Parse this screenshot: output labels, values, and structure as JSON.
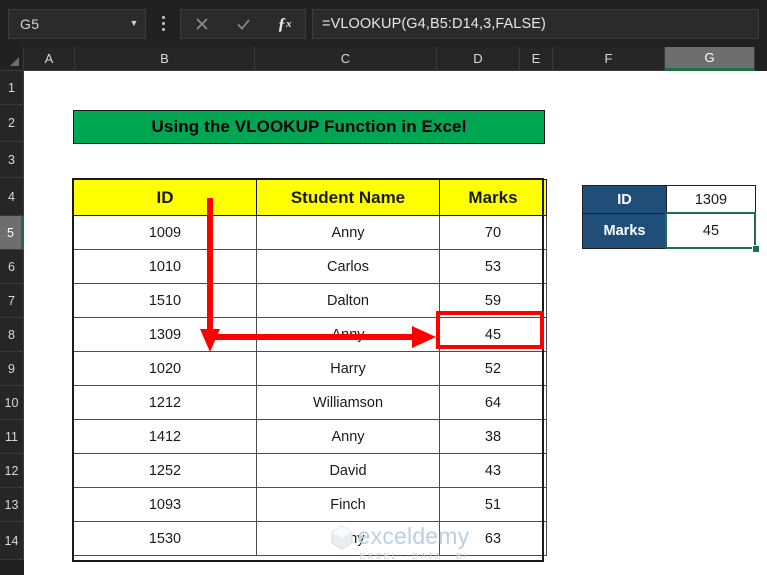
{
  "app": {
    "name_box": "G5",
    "formula": "=VLOOKUP(G4,B5:D14,3,FALSE)",
    "cancel_icon": "close-icon",
    "confirm_icon": "check-icon",
    "fx_icon": "fx-icon",
    "caret_icon": "chevron-down-icon",
    "menu_icon": "kebab-menu-icon"
  },
  "grid": {
    "columns": [
      "A",
      "B",
      "C",
      "D",
      "E",
      "F",
      "G"
    ],
    "selected_column": "G",
    "rows": [
      "1",
      "2",
      "3",
      "4",
      "5",
      "6",
      "7",
      "8",
      "9",
      "10",
      "11",
      "12",
      "13",
      "14"
    ],
    "selected_row": "5"
  },
  "banner": {
    "title": "Using the VLOOKUP Function in Excel",
    "bg_color": "#00a651",
    "text_color": "#000000"
  },
  "table": {
    "header_bg": "#ffff00",
    "headers": [
      "ID",
      "Student Name",
      "Marks"
    ],
    "rows": [
      {
        "id": "1009",
        "name": "Anny",
        "marks": "70"
      },
      {
        "id": "1010",
        "name": "Carlos",
        "marks": "53"
      },
      {
        "id": "1510",
        "name": "Dalton",
        "marks": "59"
      },
      {
        "id": "1309",
        "name": "Anny",
        "marks": "45"
      },
      {
        "id": "1020",
        "name": "Harry",
        "marks": "52"
      },
      {
        "id": "1212",
        "name": "Williamson",
        "marks": "64"
      },
      {
        "id": "1412",
        "name": "Anny",
        "marks": "38"
      },
      {
        "id": "1252",
        "name": "David",
        "marks": "43"
      },
      {
        "id": "1093",
        "name": "Finch",
        "marks": "51"
      },
      {
        "id": "1530",
        "name": "Anny",
        "marks": "63"
      }
    ]
  },
  "lookup": {
    "label_bg": "#1f4e79",
    "id_label": "ID",
    "id_value": "1309",
    "marks_label": "Marks",
    "marks_value": "45"
  },
  "annotations": {
    "highlight_color": "#ff0000",
    "selection_color": "#1d7044",
    "down_arrow": "red-down-arrow",
    "right_arrow": "red-right-arrow",
    "result_box": "red-highlight-box"
  },
  "watermark": {
    "text": "exceldemy",
    "subtitle": "EXCEL - DATA - BI"
  }
}
